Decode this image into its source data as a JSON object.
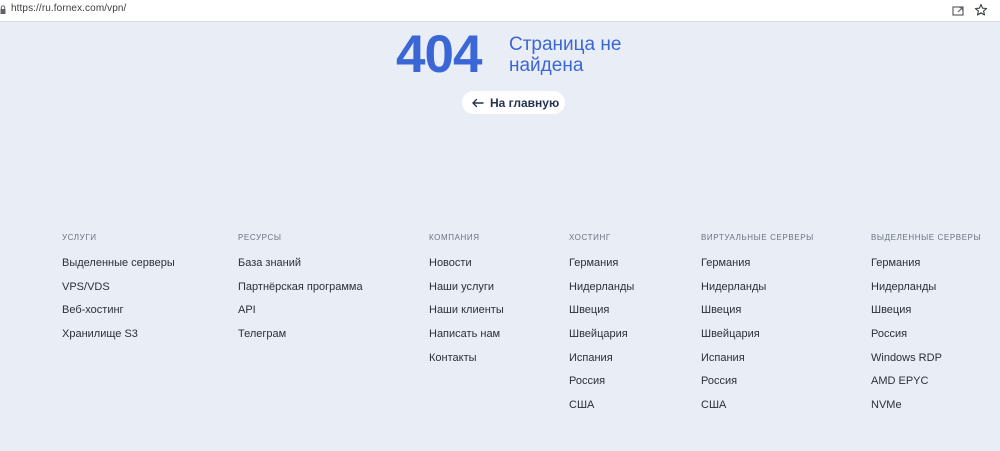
{
  "browser": {
    "url": "https://ru.fornex.com/vpn/"
  },
  "hero": {
    "code": "404",
    "message": "Страница не найдена",
    "home_button_label": "На главную",
    "accent_color": "#3b66d6"
  },
  "footer": {
    "columns": [
      {
        "heading": "УСЛУГИ",
        "links": [
          "Выделенные серверы",
          "VPS/VDS",
          "Веб-хостинг",
          "Хранилище S3"
        ]
      },
      {
        "heading": "РЕСУРСЫ",
        "links": [
          "База знаний",
          "Партнёрская программа",
          "API",
          "Телеграм"
        ]
      },
      {
        "heading": "КОМПАНИЯ",
        "links": [
          "Новости",
          "Наши услуги",
          "Наши клиенты",
          "Написать нам",
          "Контакты"
        ]
      },
      {
        "heading": "ХОСТИНГ",
        "links": [
          "Германия",
          "Нидерланды",
          "Швеция",
          "Швейцария",
          "Испания",
          "Россия",
          "США"
        ]
      },
      {
        "heading": "ВИРТУАЛЬНЫЕ СЕРВЕРЫ",
        "links": [
          "Германия",
          "Нидерланды",
          "Швеция",
          "Швейцария",
          "Испания",
          "Россия",
          "США"
        ]
      },
      {
        "heading": "ВЫДЕЛЕННЫЕ СЕРВЕРЫ",
        "links": [
          "Германия",
          "Нидерланды",
          "Швеция",
          "Россия",
          "Windows RDP",
          "AMD EPYC",
          "NVMe"
        ]
      }
    ]
  },
  "icons": {
    "lock": "lock-icon",
    "share": "share-icon",
    "bookmark": "star-icon",
    "back_arrow": "arrow-left-icon"
  }
}
